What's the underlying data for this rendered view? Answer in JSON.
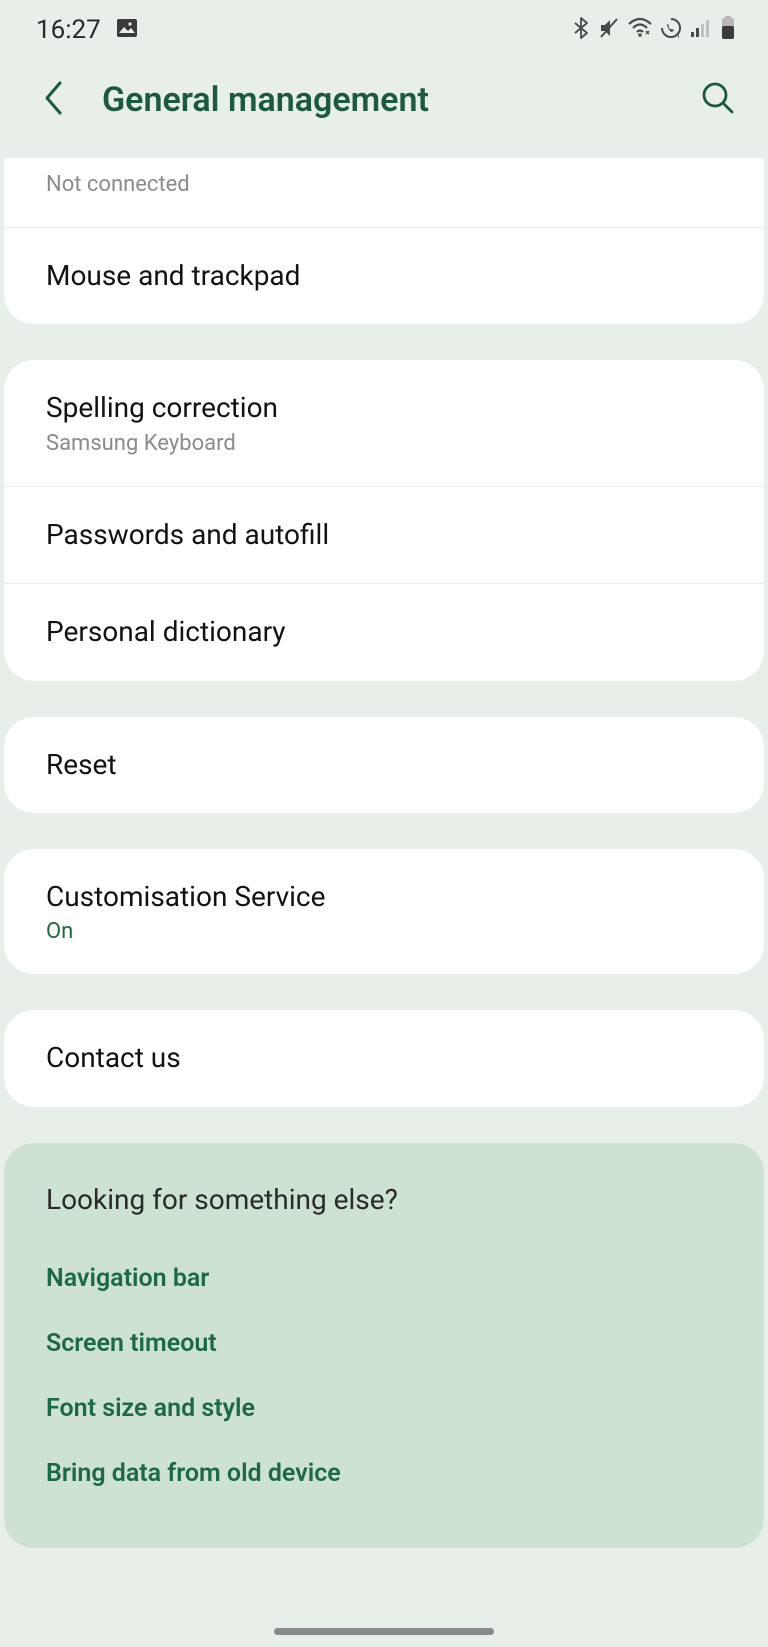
{
  "status": {
    "time": "16:27"
  },
  "header": {
    "title": "General management"
  },
  "group1": {
    "row0_sub": "Not connected",
    "row1_title": "Mouse and trackpad"
  },
  "group2": {
    "row0_title": "Spelling correction",
    "row0_sub": "Samsung Keyboard",
    "row1_title": "Passwords and autofill",
    "row2_title": "Personal dictionary"
  },
  "group3": {
    "row0_title": "Reset"
  },
  "group4": {
    "row0_title": "Customisation Service",
    "row0_sub": "On"
  },
  "group5": {
    "row0_title": "Contact us"
  },
  "suggest": {
    "title": "Looking for something else?",
    "links": {
      "0": "Navigation bar",
      "1": "Screen timeout",
      "2": "Font size and style",
      "3": "Bring data from old device"
    }
  }
}
